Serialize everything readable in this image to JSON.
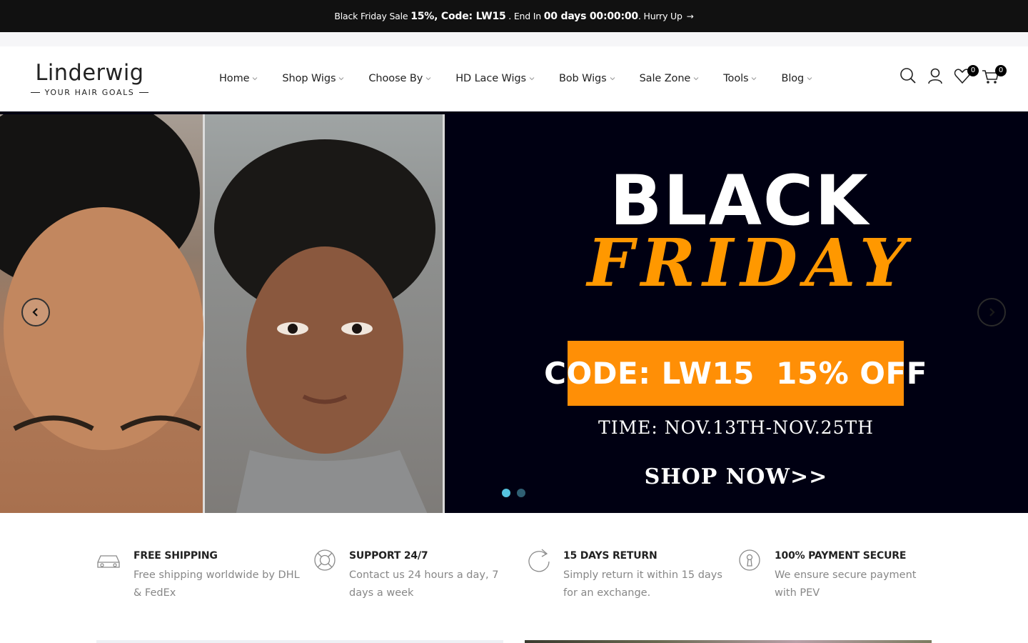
{
  "announcement": {
    "prefix": "Black Friday Sale ",
    "highlight": "15%, Code: LW15",
    "middle": " . End In ",
    "countdown": "00 days 00:00:00",
    "suffix": ". Hurry Up",
    "arrow": "→"
  },
  "logo": {
    "name": "Linderwig",
    "tagline": "YOUR HAIR GOALS"
  },
  "nav": [
    {
      "label": "Home"
    },
    {
      "label": "Shop Wigs"
    },
    {
      "label": "Choose By"
    },
    {
      "label": "HD Lace Wigs"
    },
    {
      "label": "Bob Wigs"
    },
    {
      "label": "Sale Zone"
    },
    {
      "label": "Tools"
    },
    {
      "label": "Blog"
    }
  ],
  "header_icons": {
    "search": "search-icon",
    "account": "user-icon",
    "wishlist": "heart-icon",
    "wishlist_count": "0",
    "cart": "cart-icon",
    "cart_count": "0"
  },
  "hero": {
    "line1": "BLACK",
    "line2": "FRIDAY",
    "code": "CODE: LW15  15% OFF",
    "time": "TIME: NOV.13TH-NOV.25TH",
    "cta": "SHOP NOW>>",
    "slides_total": 2,
    "active_slide": 1,
    "colors": {
      "background": "#000012",
      "accent": "#ff8f06",
      "dot_active": "#56c3df",
      "dot_inactive": "#2f5f73"
    }
  },
  "features": [
    {
      "icon": "car-icon",
      "title": "FREE SHIPPING",
      "text_line1": "Free shipping worldwide by DHL",
      "text_line2": "& FedEx"
    },
    {
      "icon": "lifebuoy-icon",
      "title": "SUPPORT 24/7",
      "text_line1": "Contact us 24 hours a day, 7",
      "text_line2": "days a week"
    },
    {
      "icon": "refresh-icon",
      "title": "15 DAYS RETURN",
      "text_line1": "Simply return it within 15 days",
      "text_line2": "for an exchange."
    },
    {
      "icon": "lock-icon",
      "title": "100% PAYMENT SECURE",
      "text_line1": "We ensure secure payment",
      "text_line2": "with PEV"
    }
  ]
}
